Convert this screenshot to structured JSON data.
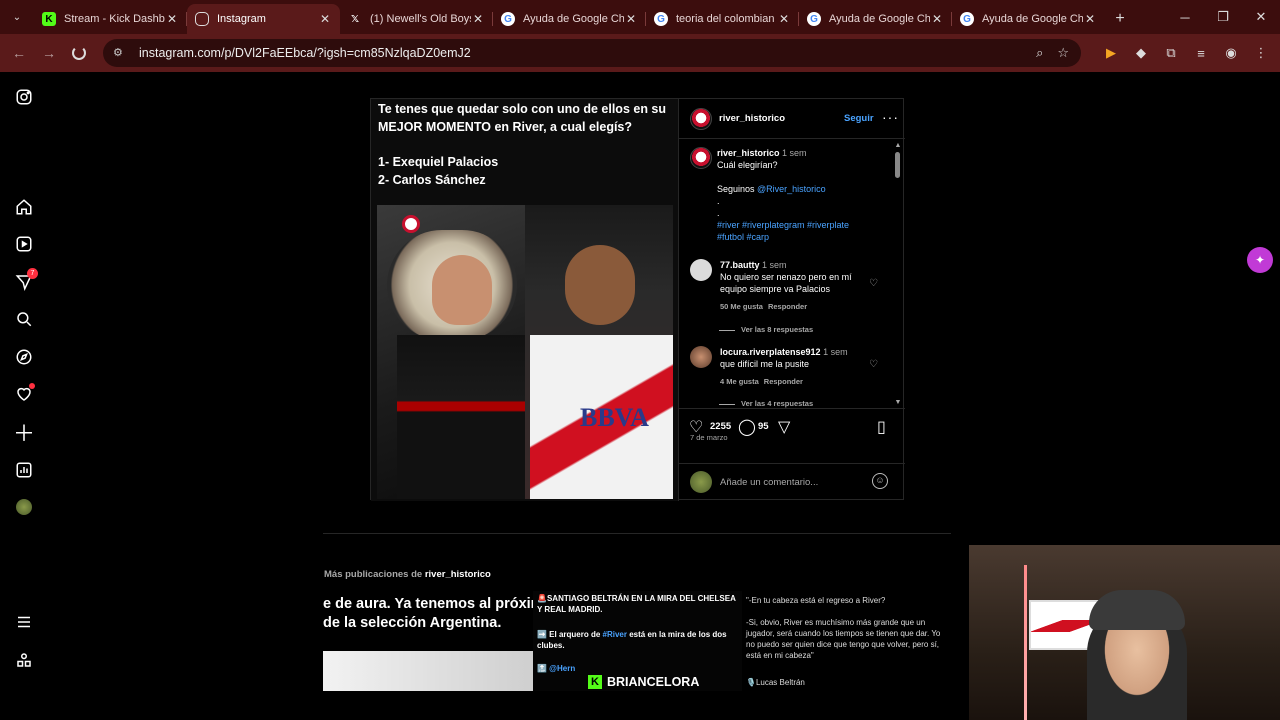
{
  "browser": {
    "tabs": [
      {
        "title": "Stream - Kick Dashb",
        "icon": "kick-icon",
        "active": false
      },
      {
        "title": "Instagram",
        "icon": "instagram-icon",
        "active": true
      },
      {
        "title": "(1) Newell's Old Boys",
        "icon": "x-icon",
        "active": false
      },
      {
        "title": "Ayuda de Google Ch",
        "icon": "google-icon",
        "active": false
      },
      {
        "title": "teoria del colombian",
        "icon": "google-icon",
        "active": false
      },
      {
        "title": "Ayuda de Google Ch",
        "icon": "google-icon",
        "active": false
      },
      {
        "title": "Ayuda de Google Ch",
        "icon": "google-icon",
        "active": false
      }
    ],
    "url": "instagram.com/p/DVl2FaEEbca/?igsh=cm85NzlqaDZ0emJ2",
    "new_tab_glyph": "+",
    "close_glyph": "✕"
  },
  "sidebar": {
    "notifications_badge": "7"
  },
  "post": {
    "question": "Te tenes que quedar solo con uno de ellos en su MEJOR MOMENTO en River, a cual elegís?",
    "option1": "1- Exequiel Palacios",
    "option2": "2- Carlos Sánchez",
    "author": "river_historico",
    "follow_label": "Seguir",
    "caption": {
      "user": "river_historico",
      "time": "1 sem",
      "line1": "Cuál elegirían?",
      "line2_prefix": "Seguinos ",
      "line2_mention": "@River_historico",
      "dot1": ".",
      "dot2": ".",
      "hashtags1": "#river #riverplategram #riverplate",
      "hashtags2": "#futbol #carp"
    },
    "comments": [
      {
        "user": "77.bautty",
        "time": "1 sem",
        "text": "No quiero ser nenazo pero en mí equipo siempre va Palacios",
        "likes": "50 Me gusta",
        "reply": "Responder",
        "replies": "Ver las 8 respuestas"
      },
      {
        "user": "locura.riverplatense912",
        "time": "1 sem",
        "text": "que difícil me la pusite",
        "likes": "4 Me gusta",
        "reply": "Responder",
        "replies": "Ver las 4 respuestas"
      }
    ],
    "likes": "2255",
    "comment_count": "95",
    "date": "7 de marzo",
    "add_comment_placeholder": "Añade un comentario..."
  },
  "more": {
    "label": "Más publicaciones de ",
    "user": "river_historico",
    "thumb1_line1": "e de aura. Ya tenemos al próxim",
    "thumb1_line2": "de la selección Argentina.",
    "thumb2_l1": "🚨SANTIAGO BELTRÁN EN LA MIRA DEL CHELSEA Y REAL MADRID.",
    "thumb2_l2a": "➡️ El arquero de ",
    "thumb2_l2b": "#River",
    "thumb2_l2c": " está en la mira de los dos clubes.",
    "thumb2_l3": "🔝 @Hern",
    "thumb3_l1": "\"-En tu cabeza está el regreso a River?",
    "thumb3_l2": "-Si, obvio, River es muchísimo más grande que un jugador, será cuando los tiempos se tienen que dar. Yo no puedo ser quien dice que tengo que volver, pero sí, está en mi cabeza\"",
    "thumb3_l3": "🎙️Lucas Beltrán"
  },
  "overlay": {
    "kick_name": "BRIANCELORA"
  }
}
